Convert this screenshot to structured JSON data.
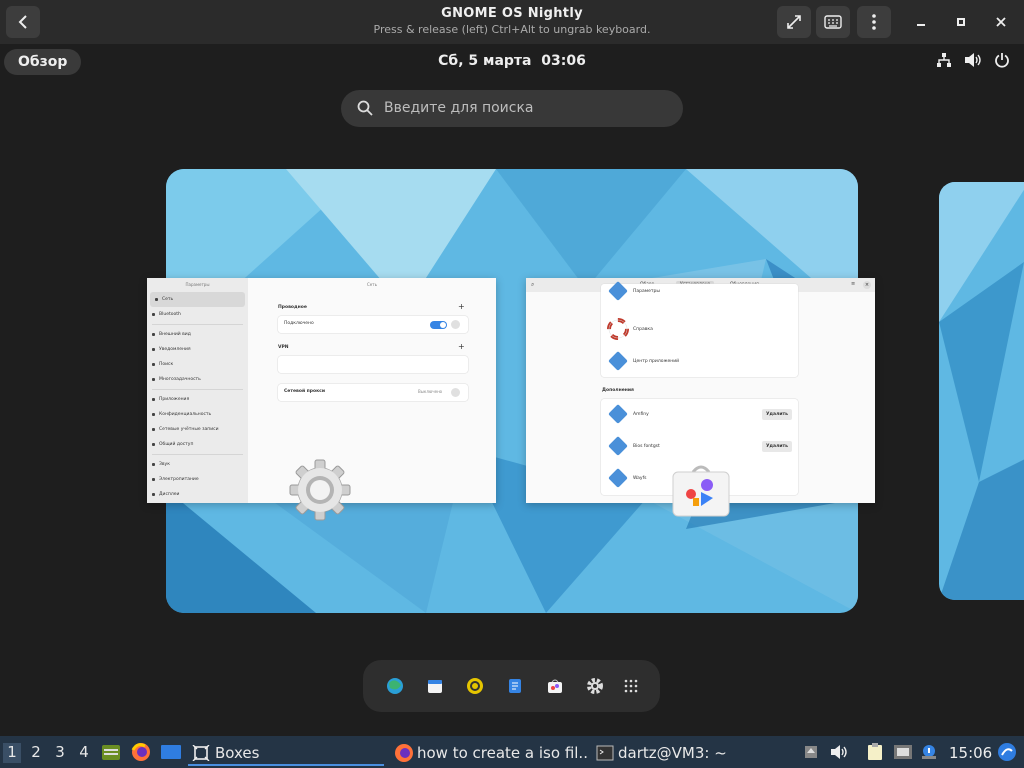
{
  "window": {
    "title": "GNOME OS Nightly",
    "subtitle": "Press & release (left) Ctrl+Alt to ungrab keyboard."
  },
  "panel": {
    "overview_label": "Обзор",
    "date": "Сб, 5 марта",
    "time": "03:06"
  },
  "search": {
    "placeholder": "Введите для поиска"
  },
  "settings_window": {
    "sidebar_title": "Параметры",
    "main_title": "Сеть",
    "sidebar_items": [
      "Сеть",
      "Bluetooth",
      "Внешний вид",
      "Уведомления",
      "Поиск",
      "Многозадачность",
      "Приложения",
      "Конфиденциальность",
      "Сетевые учётные записи",
      "Общий доступ",
      "Звук",
      "Электропитание",
      "Дисплеи"
    ],
    "section_wired": "Проводное",
    "wired_status": "Подключено",
    "section_vpn": "VPN",
    "proxy_label": "Сетевой прокси",
    "proxy_value": "Выключено"
  },
  "software_window": {
    "tabs": [
      "Обзор",
      "Установлено",
      "Обновления"
    ],
    "apps_top": [
      "Параметры",
      "Справка",
      "Центр приложений"
    ],
    "addons_title": "Дополнения",
    "addons": [
      "Amfiny",
      "Bios fontgst",
      "Wayfs"
    ],
    "remove_label": "Удалить"
  },
  "dash": {
    "icons": [
      "web-browser-icon",
      "calendar-icon",
      "disk-usage-icon",
      "text-editor-icon",
      "software-store-icon",
      "settings-gear-icon",
      "app-grid-icon"
    ]
  },
  "taskbar": {
    "workspaces": [
      "1",
      "2",
      "3",
      "4"
    ],
    "tasks": [
      "Boxes",
      "how to create a iso fil...",
      "dartz@VM3: ~"
    ],
    "clock": "15:06"
  }
}
